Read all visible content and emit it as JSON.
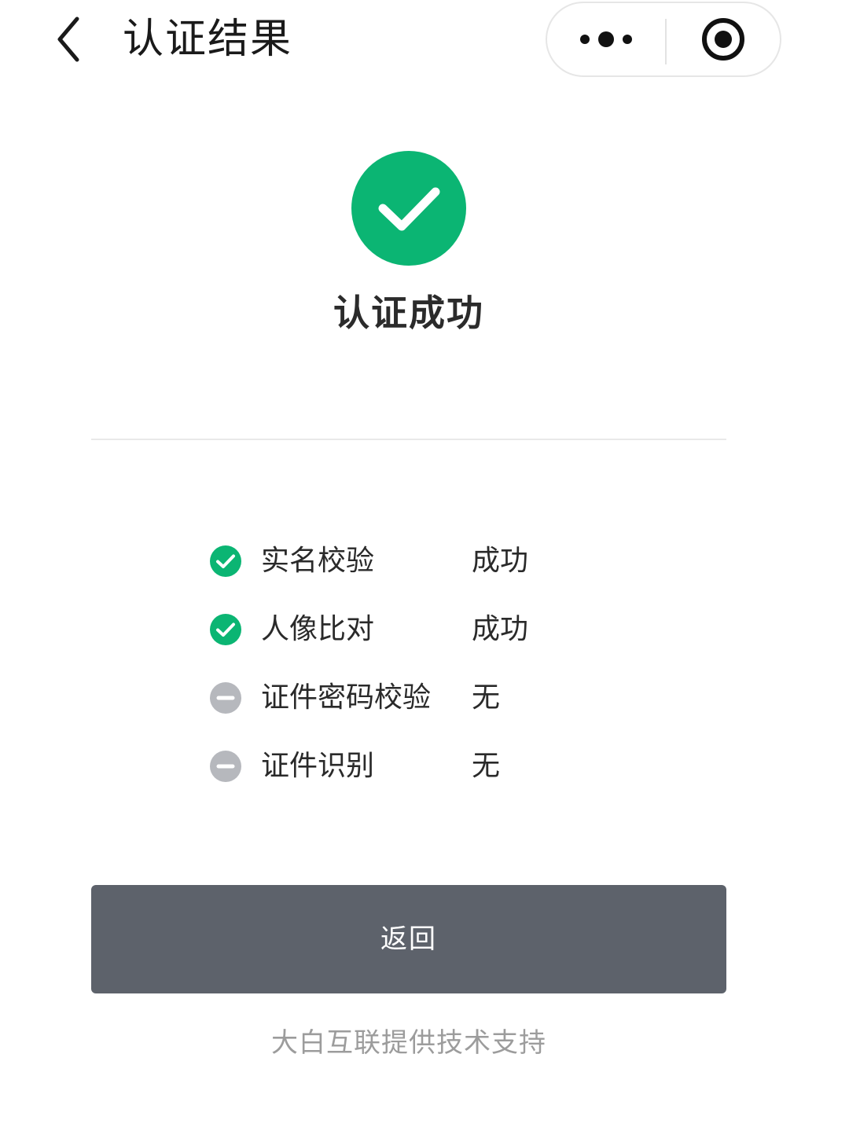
{
  "header": {
    "title": "认证结果",
    "back_icon": "chevron-left-icon",
    "more_icon": "more-dots-icon",
    "close_icon": "target-circle-icon"
  },
  "result": {
    "status_icon": "success-check-icon",
    "title": "认证成功"
  },
  "checks": [
    {
      "label": "实名校验",
      "value": "成功",
      "status": "success"
    },
    {
      "label": "人像比对",
      "value": "成功",
      "status": "success"
    },
    {
      "label": "证件密码校验",
      "value": "无",
      "status": "none"
    },
    {
      "label": "证件识别",
      "value": "无",
      "status": "none"
    }
  ],
  "actions": {
    "return_label": "返回"
  },
  "footer": {
    "text": "大白互联提供技术支持"
  },
  "colors": {
    "success": "#0bb573",
    "neutral": "#b6b8bd",
    "button": "#5d626b"
  }
}
